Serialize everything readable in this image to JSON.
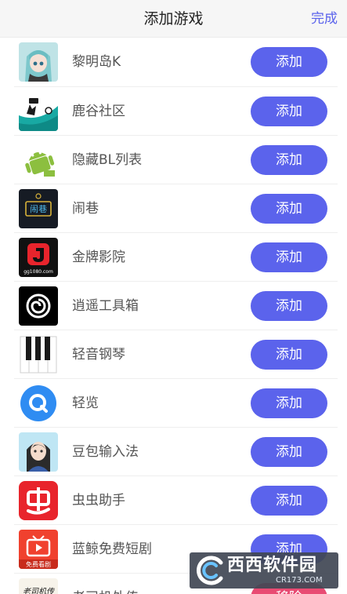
{
  "header": {
    "title": "添加游戏",
    "done_label": "完成"
  },
  "apps": [
    {
      "name": "黎明岛K",
      "icon": "anime-girl-icon",
      "action": "添加"
    },
    {
      "name": "鹿谷社区",
      "icon": "deer-valley-icon",
      "action": "添加"
    },
    {
      "name": "隐藏BL列表",
      "icon": "android-robot-icon",
      "action": "添加"
    },
    {
      "name": "闹巷",
      "icon": "neon-sign-icon",
      "action": "添加"
    },
    {
      "name": "金牌影院",
      "icon": "gold-cinema-icon",
      "action": "添加"
    },
    {
      "name": "逍遥工具箱",
      "icon": "spiral-icon",
      "action": "添加"
    },
    {
      "name": "轻音钢琴",
      "icon": "piano-keys-icon",
      "action": "添加"
    },
    {
      "name": "轻览",
      "icon": "search-q-icon",
      "action": "添加"
    },
    {
      "name": "豆包输入法",
      "icon": "girl-avatar-icon",
      "action": "添加"
    },
    {
      "name": "虫虫助手",
      "icon": "chongchong-icon",
      "action": "添加"
    },
    {
      "name": "蓝鲸免费短剧",
      "icon": "tv-icon",
      "action": "添加"
    },
    {
      "name": "老司机外传",
      "icon": "calligraphy-icon",
      "action": "移除"
    }
  ],
  "icon_texts": {
    "app4": "闹巷",
    "app5": "gg1080.com",
    "app11": "免费看剧",
    "app12": "老司机传"
  },
  "watermark": {
    "main": "西西软件园",
    "sub": "CR173.COM"
  },
  "colors": {
    "accent": "#5b63ec",
    "remove": "#e94b73"
  }
}
